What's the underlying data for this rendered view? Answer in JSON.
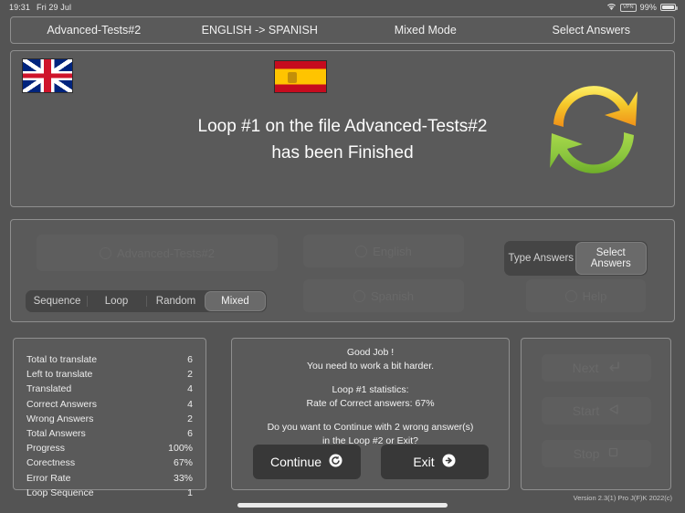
{
  "statusbar": {
    "time": "19:31",
    "date": "Fri 29 Jul",
    "wifi_icon": "wifi-icon",
    "vpn_label": "VPN",
    "battery_percent": "99%",
    "battery_icon": "battery-icon"
  },
  "navbar": {
    "items": [
      {
        "label": "Advanced-Tests#2",
        "name": "nav-item-file"
      },
      {
        "label": "ENGLISH -> SPANISH",
        "name": "nav-item-direction"
      },
      {
        "label": "Mixed Mode",
        "name": "nav-item-mode"
      },
      {
        "label": "Select Answers",
        "name": "nav-item-answer-mode"
      }
    ]
  },
  "hero": {
    "flag_source": "united-kingdom-flag",
    "flag_target": "spain-flag",
    "message_line1": "Loop #1 on the file Advanced-Tests#2",
    "message_line2": "has been Finished",
    "loop_icon": "circular-arrows-icon",
    "loop_icon_colors": {
      "top_arrow": "#f0c020",
      "bottom_arrow": "#8cc63f"
    }
  },
  "settings": {
    "file_button": "Advanced-Tests#2",
    "english_button": "English",
    "spanish_button": "Spanish",
    "help_button": "Help",
    "mode_options": [
      "Sequence",
      "Loop",
      "Random",
      "Mixed"
    ],
    "mode_selected": "Mixed",
    "answer_options": [
      "Type Answers",
      "Select Answers"
    ],
    "answer_selected": "Select Answers"
  },
  "stats": {
    "rows": [
      {
        "label": "Total to translate",
        "value": "6"
      },
      {
        "label": "Left to translate",
        "value": "2"
      },
      {
        "label": "Translated",
        "value": "4"
      },
      {
        "label": "Correct Answers",
        "value": "4"
      },
      {
        "label": "Wrong Answers",
        "value": "2"
      },
      {
        "label": "Total Answers",
        "value": "6"
      },
      {
        "label": "Progress",
        "value": "100%"
      },
      {
        "label": "Corectness",
        "value": "67%"
      },
      {
        "label": "Error Rate",
        "value": "33%"
      },
      {
        "label": "Loop Sequence",
        "value": "1"
      }
    ]
  },
  "dialog": {
    "line1": "Good Job !",
    "line2": "You need to work a bit harder.",
    "line3": "Loop #1 statistics:",
    "line4": "Rate of Correct answers: 67%",
    "line5": "Do you want to Continue with 2 wrong answer(s)",
    "line6": "in the Loop #2 or Exit?",
    "continue_label": "Continue",
    "continue_icon": "replay-circle-icon",
    "exit_label": "Exit",
    "exit_icon": "arrow-right-circle-icon"
  },
  "sidebuttons": {
    "next_label": "Next",
    "next_icon": "enter-arrow-icon",
    "start_label": "Start",
    "start_icon": "play-triangle-icon",
    "stop_label": "Stop",
    "stop_icon": "stop-square-icon"
  },
  "footer": {
    "version": "Version 2.3(1) Pro J(F)K 2022(c)"
  }
}
